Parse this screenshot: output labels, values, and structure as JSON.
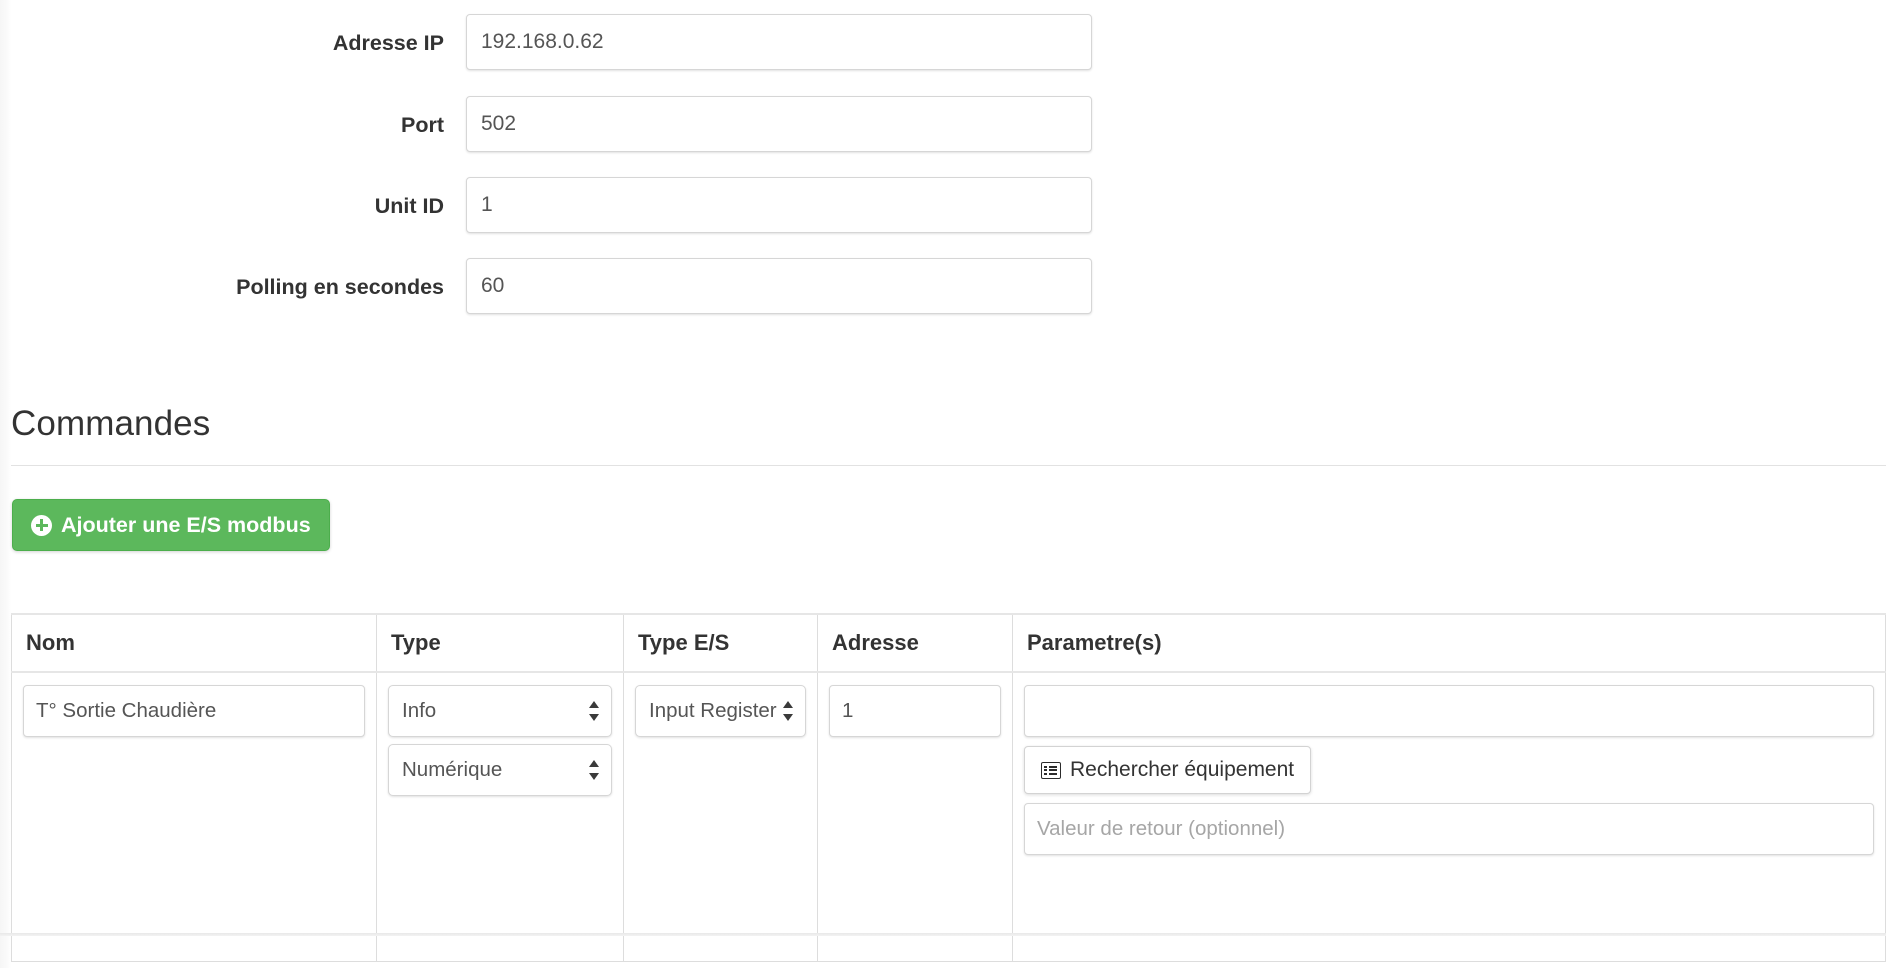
{
  "form": {
    "fields": [
      {
        "label": "Adresse IP",
        "value": "192.168.0.62"
      },
      {
        "label": "Port",
        "value": "502"
      },
      {
        "label": "Unit ID",
        "value": "1"
      },
      {
        "label": "Polling en secondes",
        "value": "60"
      }
    ]
  },
  "commands": {
    "heading": "Commandes",
    "add_button_label": "Ajouter une E/S modbus",
    "add_icon": "plus-circle-icon",
    "table": {
      "headers": [
        "Nom",
        "Type",
        "Type E/S",
        "Adresse",
        "Parametre(s)"
      ],
      "rows": [
        {
          "nom": "T° Sortie Chaudière",
          "type": "Info",
          "subtype": "Numérique",
          "type_es": "Input Register",
          "adresse": "1",
          "param_value": "",
          "search_button_label": "Rechercher équipement",
          "search_icon": "list-icon",
          "return_value_placeholder": "Valeur de retour (optionnel)"
        }
      ]
    }
  },
  "colors": {
    "accent_green": "#5cb85c",
    "accent_green_border": "#4cae4c",
    "text": "#333333",
    "input_text": "#555555",
    "placeholder": "#a6a6a6",
    "border": "#dddddd"
  }
}
